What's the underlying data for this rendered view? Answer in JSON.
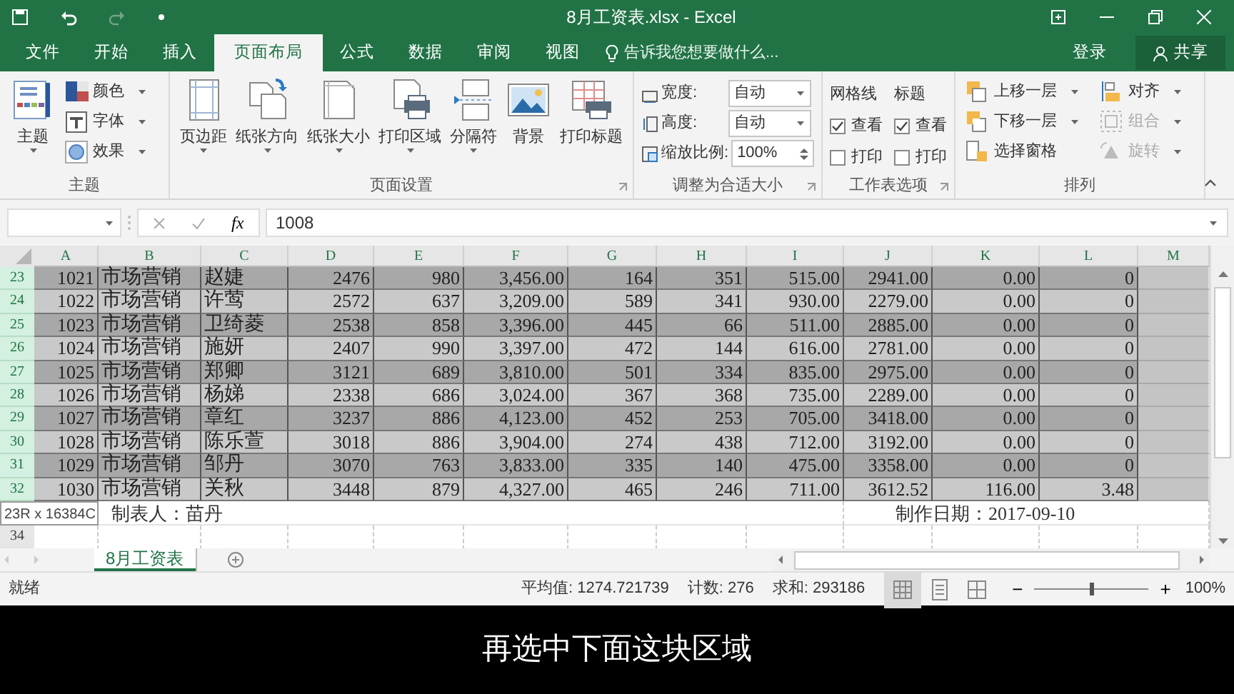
{
  "title_bar": {
    "title": "8月工资表.xlsx - Excel"
  },
  "tabs": [
    {
      "label": "文件",
      "selected": false
    },
    {
      "label": "开始",
      "selected": false
    },
    {
      "label": "插入",
      "selected": false
    },
    {
      "label": "页面布局",
      "selected": true
    },
    {
      "label": "公式",
      "selected": false
    },
    {
      "label": "数据",
      "selected": false
    },
    {
      "label": "审阅",
      "selected": false
    },
    {
      "label": "视图",
      "selected": false
    }
  ],
  "tell_me": {
    "placeholder": "告诉我您想要做什么..."
  },
  "account": {
    "sign_in": "登录",
    "share": "共享"
  },
  "ribbon": {
    "groups": [
      {
        "title": "主题",
        "kind": "buttons",
        "launcher": false,
        "items": [
          {
            "kind": "large",
            "label": "主题",
            "dropdown": true,
            "disabled": false
          },
          {
            "kind": "small",
            "label": "颜色",
            "dropdown": true,
            "disabled": false
          },
          {
            "kind": "small",
            "label": "字体",
            "dropdown": true,
            "disabled": false
          },
          {
            "kind": "small",
            "label": "效果",
            "dropdown": true,
            "disabled": false
          }
        ]
      },
      {
        "title": "页面设置",
        "kind": "buttons",
        "launcher": true,
        "items": [
          {
            "kind": "large",
            "label": "页边距",
            "dropdown": true,
            "disabled": false
          },
          {
            "kind": "large",
            "label": "纸张方向",
            "dropdown": true,
            "disabled": false
          },
          {
            "kind": "large",
            "label": "纸张大小",
            "dropdown": true,
            "disabled": false
          },
          {
            "kind": "large",
            "label": "打印区域",
            "dropdown": true,
            "disabled": false
          },
          {
            "kind": "large",
            "label": "分隔符",
            "dropdown": true,
            "disabled": false
          },
          {
            "kind": "large",
            "label": "背景",
            "dropdown": false,
            "disabled": false
          },
          {
            "kind": "large",
            "label": "打印标题",
            "dropdown": false,
            "disabled": false
          }
        ]
      },
      {
        "title": "调整为合适大小",
        "kind": "fields",
        "launcher": true,
        "fields": [
          {
            "label": "宽度:",
            "value": "自动",
            "kind": "dropdown"
          },
          {
            "label": "高度:",
            "value": "自动",
            "kind": "dropdown"
          },
          {
            "label": "缩放比例:",
            "value": "100%",
            "kind": "spin"
          }
        ]
      },
      {
        "title": "工作表选项",
        "kind": "options",
        "launcher": true,
        "columns": [
          {
            "title": "网格线",
            "checks": [
              {
                "label": "查看",
                "checked": true
              },
              {
                "label": "打印",
                "checked": false
              }
            ]
          },
          {
            "title": "标题",
            "checks": [
              {
                "label": "查看",
                "checked": true
              },
              {
                "label": "打印",
                "checked": false
              }
            ]
          }
        ]
      },
      {
        "title": "排列",
        "kind": "buttons",
        "launcher": false,
        "items": [
          {
            "kind": "small",
            "label": "上移一层",
            "dropdown": true,
            "disabled": false
          },
          {
            "kind": "small",
            "label": "下移一层",
            "dropdown": true,
            "disabled": false
          },
          {
            "kind": "small",
            "label": "选择窗格",
            "dropdown": false,
            "disabled": false
          },
          {
            "kind": "small",
            "label": "对齐",
            "dropdown": true,
            "disabled": false
          },
          {
            "kind": "small",
            "label": "组合",
            "dropdown": true,
            "disabled": true
          },
          {
            "kind": "small",
            "label": "旋转",
            "dropdown": true,
            "disabled": true
          }
        ]
      }
    ]
  },
  "formula_bar": {
    "fx": "fx",
    "value": "1008"
  },
  "sheet": {
    "columns": [
      {
        "label": "A",
        "kind": "number"
      },
      {
        "label": "B",
        "kind": "text"
      },
      {
        "label": "C",
        "kind": "text"
      },
      {
        "label": "D",
        "kind": "number"
      },
      {
        "label": "E",
        "kind": "number"
      },
      {
        "label": "F",
        "kind": "number"
      },
      {
        "label": "G",
        "kind": "number"
      },
      {
        "label": "H",
        "kind": "number"
      },
      {
        "label": "I",
        "kind": "number"
      },
      {
        "label": "J",
        "kind": "number"
      },
      {
        "label": "K",
        "kind": "number"
      },
      {
        "label": "L",
        "kind": "number"
      },
      {
        "label": "M",
        "kind": "number"
      }
    ],
    "rows": [
      {
        "number": "23",
        "selected": true,
        "cells": [
          "1021",
          "市场营销",
          "赵婕",
          "2476",
          "980",
          "3,456.00",
          "164",
          "351",
          "515.00",
          "2941.00",
          "0.00",
          "0"
        ]
      },
      {
        "number": "24",
        "selected": true,
        "cells": [
          "1022",
          "市场营销",
          "许莺",
          "2572",
          "637",
          "3,209.00",
          "589",
          "341",
          "930.00",
          "2279.00",
          "0.00",
          "0"
        ]
      },
      {
        "number": "25",
        "selected": true,
        "cells": [
          "1023",
          "市场营销",
          "卫绮菱",
          "2538",
          "858",
          "3,396.00",
          "445",
          "66",
          "511.00",
          "2885.00",
          "0.00",
          "0"
        ]
      },
      {
        "number": "26",
        "selected": true,
        "cells": [
          "1024",
          "市场营销",
          "施妍",
          "2407",
          "990",
          "3,397.00",
          "472",
          "144",
          "616.00",
          "2781.00",
          "0.00",
          "0"
        ]
      },
      {
        "number": "27",
        "selected": true,
        "cells": [
          "1025",
          "市场营销",
          "郑卿",
          "3121",
          "689",
          "3,810.00",
          "501",
          "334",
          "835.00",
          "2975.00",
          "0.00",
          "0"
        ]
      },
      {
        "number": "28",
        "selected": true,
        "cells": [
          "1026",
          "市场营销",
          "杨娣",
          "2338",
          "686",
          "3,024.00",
          "367",
          "368",
          "735.00",
          "2289.00",
          "0.00",
          "0"
        ]
      },
      {
        "number": "29",
        "selected": true,
        "cells": [
          "1027",
          "市场营销",
          "章红",
          "3237",
          "886",
          "4,123.00",
          "452",
          "253",
          "705.00",
          "3418.00",
          "0.00",
          "0"
        ]
      },
      {
        "number": "30",
        "selected": true,
        "cells": [
          "1028",
          "市场营销",
          "陈乐萱",
          "3018",
          "886",
          "3,904.00",
          "274",
          "438",
          "712.00",
          "3192.00",
          "0.00",
          "0"
        ]
      },
      {
        "number": "31",
        "selected": true,
        "cells": [
          "1029",
          "市场营销",
          "邹丹",
          "3070",
          "763",
          "3,833.00",
          "335",
          "140",
          "475.00",
          "3358.00",
          "0.00",
          "0"
        ]
      },
      {
        "number": "32",
        "selected": true,
        "cells": [
          "1030",
          "市场营销",
          "关秋",
          "3448",
          "879",
          "4,327.00",
          "465",
          "246",
          "711.00",
          "3612.52",
          "116.00",
          "3.48"
        ]
      }
    ],
    "selection_tooltip": "23R x 16384C",
    "note_row": {
      "left": "制表人：苗丹",
      "right": "制作日期：2017-09-10"
    },
    "empty_rows": [
      {
        "number": "34"
      }
    ]
  },
  "sheet_tabs": [
    {
      "label": "8月工资表",
      "selected": true
    }
  ],
  "status_bar": {
    "state": "就绪",
    "stats": [
      "平均值: 1274.721739",
      "计数: 276",
      "求和: 293186"
    ],
    "views": [
      {
        "selected": true
      },
      {
        "selected": false
      },
      {
        "selected": false
      }
    ],
    "zoom": {
      "level": 0.5,
      "minus": "−",
      "plus": "+",
      "value": "100%"
    }
  },
  "caption": "再选中下面这块区域"
}
